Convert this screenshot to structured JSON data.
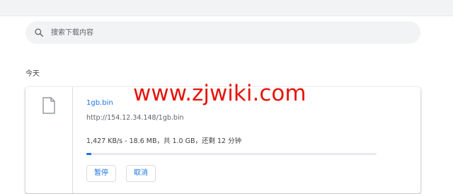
{
  "search": {
    "placeholder": "搜索下载内容",
    "icon": "search-icon"
  },
  "section": {
    "title": "今天"
  },
  "download": {
    "file_name": "1gb.bin",
    "url": "http://154.12.34.148/1gb.bin",
    "status": "1,427 KB/s - 18.6 MB，共 1.0 GB，还剩 12 分钟",
    "progress_fraction": 0.018,
    "file_icon": "file-icon",
    "pause_label": "暂停",
    "cancel_label": "取消"
  },
  "watermark": {
    "text": "www.zjwiki.com",
    "color": "#e8140e"
  },
  "colors": {
    "accent": "#1a73e8",
    "search_bg": "#f1f3f4"
  }
}
